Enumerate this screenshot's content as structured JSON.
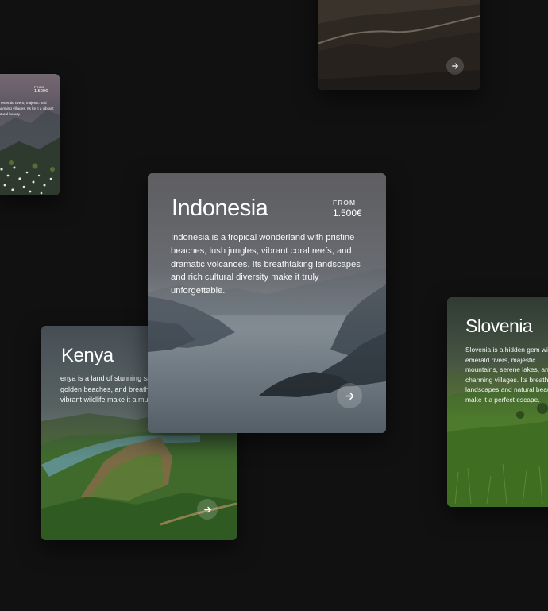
{
  "cards": {
    "top": {
      "arrow_icon": "arrow-right-icon"
    },
    "small": {
      "price_from": "FROM",
      "price_value": "1.500€",
      "description": "th emerald rivers, majestic and charming villages. Its ke it a vibrant natural beauty"
    },
    "indonesia": {
      "title": "Indonesia",
      "price_from": "FROM",
      "price_value": "1.500€",
      "description": "Indonesia is a tropical wonderland with pristine beaches, lush jungles, vibrant coral reefs, and dramatic volcanoes. Its breathtaking landscapes and rich cultural diversity make it truly unforgettable.",
      "arrow_icon": "arrow-right-icon"
    },
    "kenya": {
      "title": "Kenya",
      "description": "enya is a land of stunning savannas, majestic mountains, golden beaches, and breathtaking landscapes and vibrant wildlife make it a must-visit destination.",
      "arrow_icon": "arrow-right-icon"
    },
    "slovenia": {
      "title": "Slovenia",
      "description": "Slovenia is a hidden gem with emerald rivers, majestic mountains, serene lakes, and charming villages. Its breathtaking landscapes and natural beauty make it a perfect escape."
    }
  },
  "colors": {
    "page_background": "#111111",
    "card_text": "#ffffff"
  }
}
